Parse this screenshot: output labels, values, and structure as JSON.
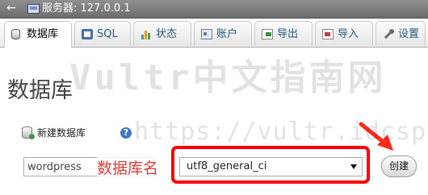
{
  "topbar": {
    "back_glyph": "←",
    "server_label": "服务器: 127.0.0.1",
    "icon": "server-icon"
  },
  "tabs": [
    {
      "label": "数据库",
      "icon": "database-icon",
      "active": true
    },
    {
      "label": "SQL",
      "icon": "sql-icon"
    },
    {
      "label": "状态",
      "icon": "status-chart-icon"
    },
    {
      "label": "账户",
      "icon": "account-icon"
    },
    {
      "label": "导出",
      "icon": "export-icon"
    },
    {
      "label": "导入",
      "icon": "import-icon"
    },
    {
      "label": "设置",
      "icon": "wrench-icon"
    }
  ],
  "watermark": {
    "line1": "Vultr中文指南网",
    "line2": "https://vultr.idcspy.com/"
  },
  "page_title": "数据库",
  "new_db": {
    "label": "新建数据库",
    "help": "?"
  },
  "form": {
    "db_name_value": "wordpress",
    "annotation": "数据库名",
    "collation_selected": "utf8_general_ci",
    "create_label": "创建"
  },
  "colors": {
    "highlight": "#ff0000",
    "annotation": "#e53935",
    "link": "#235a81"
  }
}
